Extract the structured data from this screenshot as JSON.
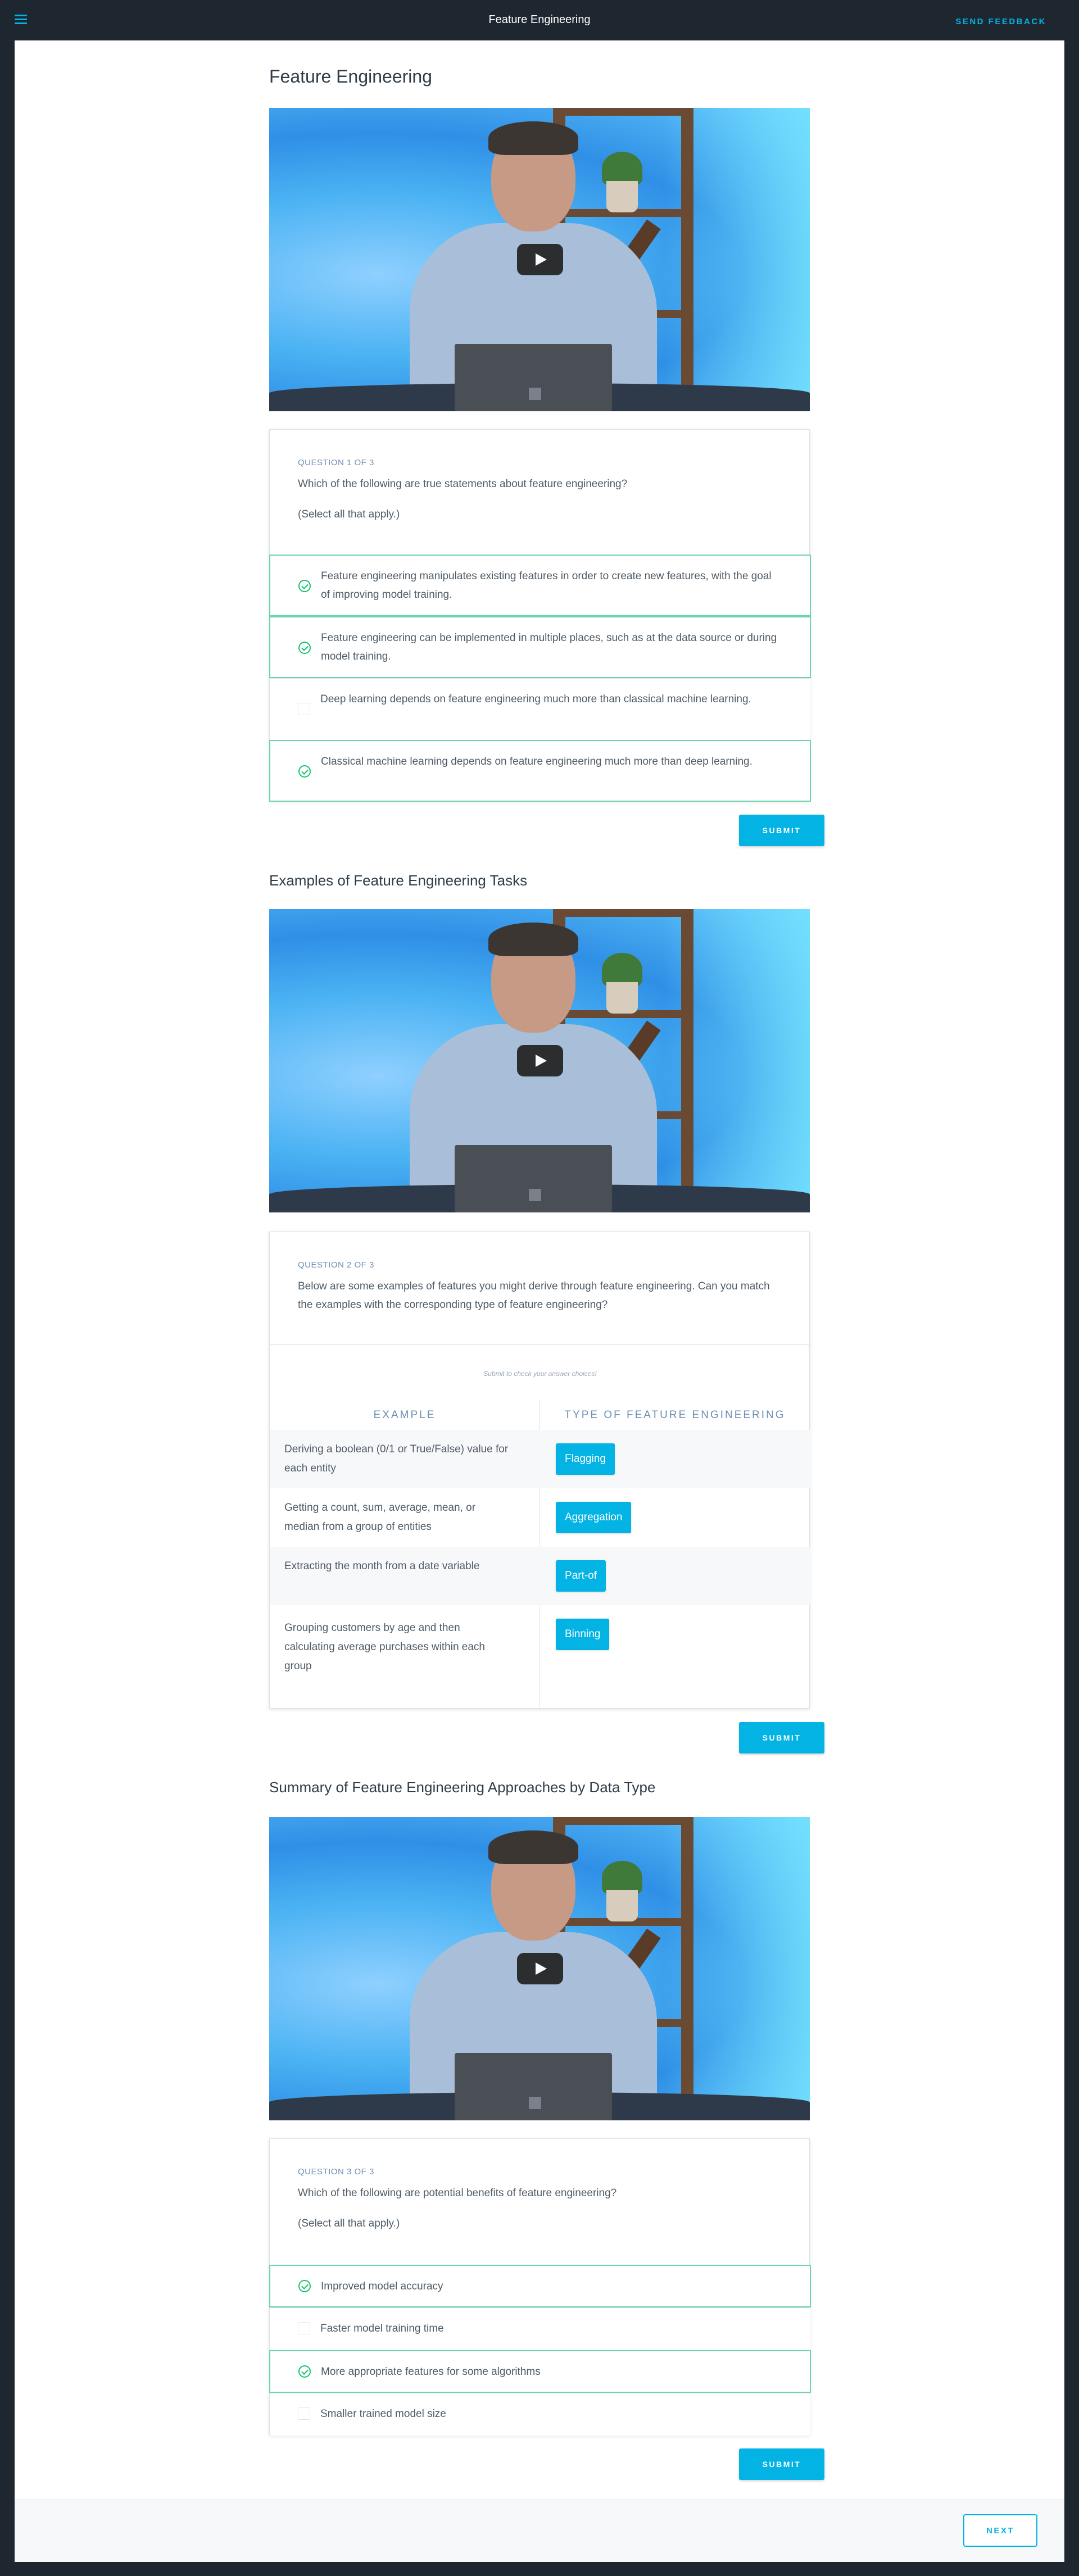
{
  "topbar": {
    "title": "Feature Engineering",
    "feedback": "SEND FEEDBACK"
  },
  "sections": [
    {
      "heading": "Feature Engineering"
    },
    {
      "heading": "Examples of Feature Engineering Tasks"
    },
    {
      "heading": "Summary of Feature Engineering Approaches by Data Type"
    }
  ],
  "q1": {
    "label": "QUESTION 1 OF 3",
    "text": "Which of the following are true statements about feature engineering?",
    "note": "(Select all that apply.)",
    "options": [
      {
        "text": "Feature engineering manipulates existing features in order to create new features, with the goal of improving model training.",
        "checked": true
      },
      {
        "text": "Feature engineering can be implemented in multiple places, such as at the data source or during model training.",
        "checked": true
      },
      {
        "text": "Deep learning depends on feature engineering much more than classical machine learning.",
        "checked": false
      },
      {
        "text": "Classical machine learning depends on feature engineering much more than deep learning.",
        "checked": true
      }
    ],
    "submit": "SUBMIT"
  },
  "q2": {
    "label": "QUESTION 2 OF 3",
    "text": "Below are some examples of features you might derive through feature engineering. Can you match the examples with the corresponding type of feature engineering?",
    "hint": "Submit to check your answer choices!",
    "col_example": "EXAMPLE",
    "col_type": "TYPE OF FEATURE ENGINEERING",
    "rows": [
      {
        "example": "Deriving a boolean (0/1 or True/False) value for each entity",
        "type": "Flagging"
      },
      {
        "example": "Getting a count, sum, average, mean, or median from a group of entities",
        "type": "Aggregation"
      },
      {
        "example": "Extracting the month from a date variable",
        "type": "Part-of"
      },
      {
        "example": "Grouping customers by age and then calculating average purchases within each group",
        "type": "Binning"
      }
    ],
    "submit": "SUBMIT"
  },
  "q3": {
    "label": "QUESTION 3 OF 3",
    "text": "Which of the following are potential benefits of feature engineering?",
    "note": "(Select all that apply.)",
    "options": [
      {
        "text": "Improved model accuracy",
        "checked": true
      },
      {
        "text": "Faster model training time",
        "checked": false
      },
      {
        "text": "More appropriate features for some algorithms",
        "checked": true
      },
      {
        "text": "Smaller trained model size",
        "checked": false
      }
    ],
    "submit": "SUBMIT"
  },
  "footer": {
    "next": "NEXT"
  },
  "colors": {
    "accent": "#02b3e4",
    "check": "#15c26b",
    "selected_border": "#6dd4b0",
    "topbar": "#1e2630"
  },
  "icons": {
    "menu": "hamburger-menu-icon",
    "play": "play-icon",
    "check": "check-circle-icon"
  }
}
